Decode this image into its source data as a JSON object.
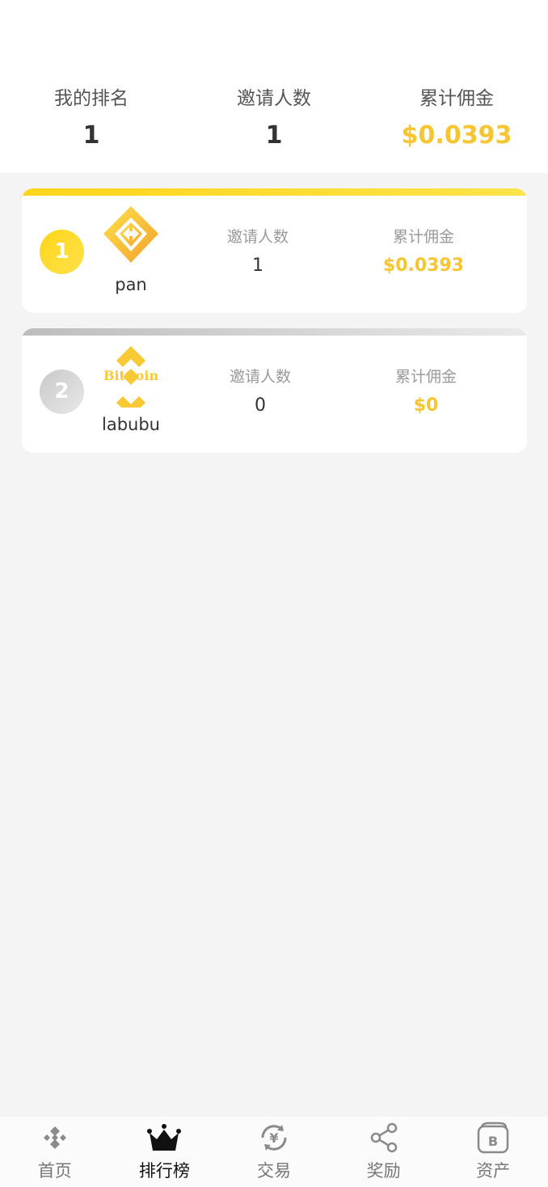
{
  "summary": {
    "my_rank_label": "我的排名",
    "my_rank_value": "1",
    "invites_label": "邀请人数",
    "invites_value": "1",
    "commission_label": "累计佣金",
    "commission_value": "$0.0393"
  },
  "leaderboard": [
    {
      "rank": "1",
      "username": "pan",
      "avatar_icon": "arrows-diamond-logo-icon",
      "invites_label": "邀请人数",
      "invites_value": "1",
      "commission_label": "累计佣金",
      "commission_value": "$0.0393"
    },
    {
      "rank": "2",
      "username": "labubu",
      "avatar_icon": "bitcoin-diamond-logo-icon",
      "avatar_text": "BitCoin",
      "invites_label": "邀请人数",
      "invites_value": "0",
      "commission_label": "累计佣金",
      "commission_value": "$0"
    }
  ],
  "tabbar": [
    {
      "label": "首页",
      "icon": "home-diamond-icon",
      "active": false
    },
    {
      "label": "排行榜",
      "icon": "crown-icon",
      "active": true
    },
    {
      "label": "交易",
      "icon": "yuan-exchange-icon",
      "active": false
    },
    {
      "label": "奖励",
      "icon": "share-icon",
      "active": false
    },
    {
      "label": "资产",
      "icon": "wallet-icon",
      "active": false
    }
  ],
  "colors": {
    "accent_gold": "#f6c531",
    "first_place": "#ffd51a",
    "second_place": "#c9c9c9",
    "background": "#f4f4f4"
  }
}
